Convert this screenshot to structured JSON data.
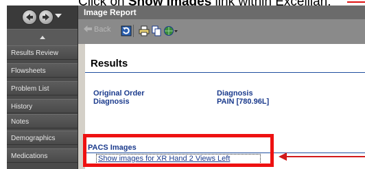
{
  "caption": {
    "prefix": "Click on ",
    "bold": "Show Images",
    "suffix": " link within Excellian.",
    "arrow_color": "#e01010"
  },
  "sidebar": {
    "items": [
      {
        "label": "Results Review"
      },
      {
        "label": "Flowsheets"
      },
      {
        "label": "Problem List"
      },
      {
        "label": "History"
      },
      {
        "label": "Notes"
      },
      {
        "label": "Demographics"
      },
      {
        "label": "Medications"
      }
    ]
  },
  "window": {
    "title": "Image Report",
    "toolbar": {
      "back_label": "Back",
      "icons": [
        "refresh-icon",
        "print-icon",
        "copy-icon",
        "globe-dropdown-icon"
      ]
    }
  },
  "content": {
    "header": "Results",
    "fields": {
      "original_order_label": "Original Order",
      "diagnosis_label": "Diagnosis",
      "diagnosis_col_label": "Diagnosis",
      "diagnosis_value": "PAIN [780.96L]"
    },
    "pacs": {
      "heading": "PACS Images",
      "link": "Show images for XR Hand 2 Views Left"
    }
  },
  "annotation": {
    "highlight_color": "#ee1111"
  }
}
